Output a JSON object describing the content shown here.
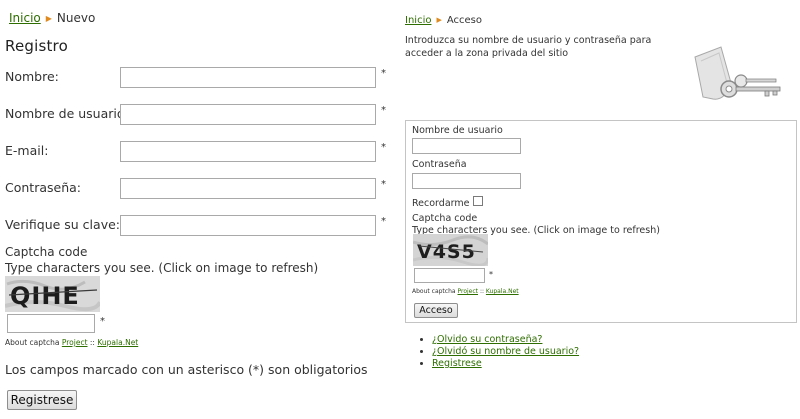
{
  "registration": {
    "breadcrumb": {
      "home": "Inicio",
      "current": "Nuevo"
    },
    "title": "Registro",
    "fields": [
      {
        "label": "Nombre:",
        "value": "",
        "required_mark": "*"
      },
      {
        "label": "Nombre de usuario:",
        "value": "",
        "required_mark": "*"
      },
      {
        "label": "E-mail:",
        "value": "",
        "required_mark": "*"
      },
      {
        "label": "Contraseña:",
        "value": "",
        "required_mark": "*"
      },
      {
        "label": "Verifique su clave:",
        "value": "",
        "required_mark": "*"
      }
    ],
    "captcha": {
      "label": "Captcha code",
      "help": "Type characters you see. (Click on image to refresh)",
      "image_text": "QIHE",
      "value": "",
      "required_mark": "*",
      "about_prefix": "About captcha",
      "project_link": "Project",
      "about_sep": "::",
      "kupala_link": "Kupala.Net"
    },
    "mandatory_note": "Los campos marcado con un asterisco (*) son obligatorios",
    "submit_label": "Registrese"
  },
  "login": {
    "breadcrumb": {
      "home": "Inicio",
      "current": "Acceso"
    },
    "intro": "Introduzca su nombre de usuario y contraseña para acceder a la zona privada del sitio",
    "image_icon": "keys-icon",
    "username_label": "Nombre de usuario",
    "username_value": "",
    "password_label": "Contraseña",
    "password_value": "",
    "remember_label": "Recordarme",
    "remember_checked": false,
    "captcha": {
      "label": "Captcha code",
      "help": "Type characters you see. (Click on image to refresh)",
      "image_text": "V4S5",
      "value": "",
      "required_mark": "*",
      "about_prefix": "About captcha",
      "project_link": "Project",
      "about_sep": "::",
      "kupala_link": "Kupala.Net"
    },
    "submit_label": "Acceso",
    "links": [
      {
        "label": "¿Olvido su contraseña?"
      },
      {
        "label": "¿Olvidó su nombre de usuario?"
      },
      {
        "label": "Registrese"
      }
    ]
  },
  "colors": {
    "link": "#2e6e00",
    "breadcrumb_arrow": "#e08a1e",
    "border": "#c4c4c4"
  }
}
